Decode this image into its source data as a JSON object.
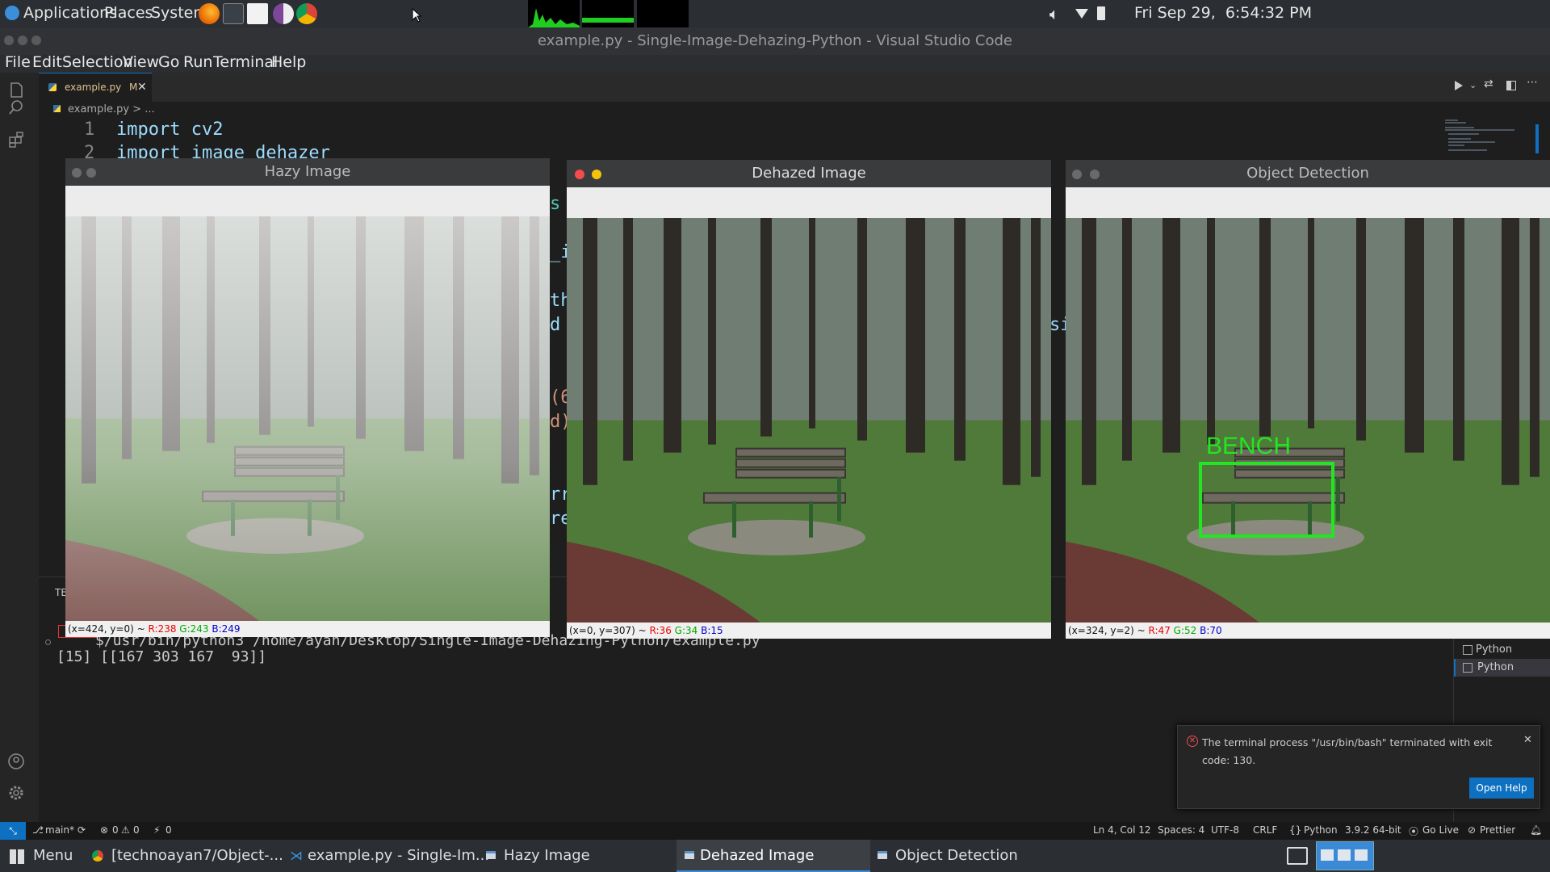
{
  "top_panel": {
    "applications": "Applications",
    "places": "Places",
    "system": "System",
    "clock": "Fri Sep 29,  6:54:32 PM"
  },
  "vscode": {
    "title": "example.py - Single-Image-Dehazing-Python - Visual Studio Code",
    "menu": [
      "File",
      "Edit",
      "Selection",
      "View",
      "Go",
      "Run",
      "Terminal",
      "Help"
    ],
    "tab_label": "example.py",
    "tab_modified": "M",
    "breadcrumb": "example.py > ...",
    "code_lines": [
      {
        "num": "1",
        "text": "import cv2"
      },
      {
        "num": "2",
        "text": "import image_dehazer"
      }
    ],
    "code_fragments": [
      "s",
      "_i",
      "th",
      "d",
      "(6",
      "d)",
      "rr",
      "re"
    ],
    "terminal_command": "$/usr/bin/python3 /home/ayan/Desktop/Single-Image-Dehazing-Python/example.py",
    "terminal_output": "[15] [[167 303 167  93]]",
    "terminal_tab_label": "TE",
    "side_fragment": "si",
    "terminal_list": [
      "Python",
      "Python"
    ],
    "notification": {
      "text": "The terminal process \"/usr/bin/bash\" terminated with exit code: 130.",
      "button": "Open Help"
    }
  },
  "windows": [
    {
      "title": "Hazy Image",
      "status_pos": "(x=424, y=0) ~",
      "r": "R:238",
      "g": "G:243",
      "b": "B:249"
    },
    {
      "title": "Dehazed Image",
      "status_pos": "(x=0, y=307) ~",
      "r": "R:36",
      "g": "G:34",
      "b": "B:15"
    },
    {
      "title": "Object Detection",
      "status_pos": "(x=324, y=2) ~",
      "r": "R:47",
      "g": "G:52",
      "b": "B:70"
    }
  ],
  "detection": {
    "label": "BENCH",
    "color": "#22e622"
  },
  "statusbar": {
    "branch": "main*",
    "errors": "0",
    "warnings": "0",
    "ports": "0",
    "position": "Ln 4, Col 12",
    "spaces": "Spaces: 4",
    "encoding": "UTF-8",
    "eol": "CRLF",
    "language": "Python",
    "interpreter": "3.9.2 64-bit",
    "golive": "Go Live",
    "prettier": "Prettier"
  },
  "taskbar": {
    "menu": "Menu",
    "items": [
      "[technoayan7/Object-...",
      "example.py - Single-Im...",
      "Hazy Image",
      "Dehazed Image",
      "Object Detection"
    ]
  },
  "colors": {
    "accent": "#0e70c0",
    "error": "#f14c4c",
    "detection": "#22e622"
  }
}
